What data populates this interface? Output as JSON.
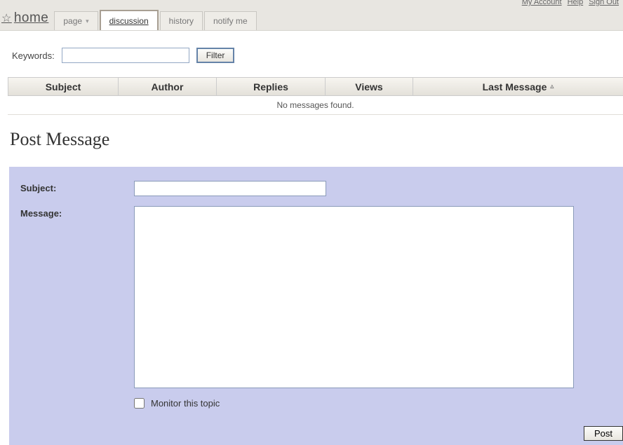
{
  "top": {
    "home": "home",
    "tabs": [
      {
        "label": "page",
        "hasDropdown": true,
        "active": false
      },
      {
        "label": "discussion",
        "hasDropdown": false,
        "active": true
      },
      {
        "label": "history",
        "hasDropdown": false,
        "active": false
      },
      {
        "label": "notify me",
        "hasDropdown": false,
        "active": false
      }
    ],
    "user_links": {
      "my_account": "My Account",
      "help": "Help",
      "sign_out": "Sign Out"
    }
  },
  "filter": {
    "keywords_label": "Keywords:",
    "keywords_value": "",
    "button": "Filter"
  },
  "grid": {
    "headers": {
      "subject": "Subject",
      "author": "Author",
      "replies": "Replies",
      "views": "Views",
      "last_message": "Last Message"
    },
    "empty_message": "No messages found."
  },
  "post": {
    "heading": "Post Message",
    "subject_label": "Subject:",
    "subject_value": "",
    "message_label": "Message:",
    "message_value": "",
    "monitor_label": "Monitor this topic",
    "monitor_checked": false,
    "post_button": "Post"
  }
}
